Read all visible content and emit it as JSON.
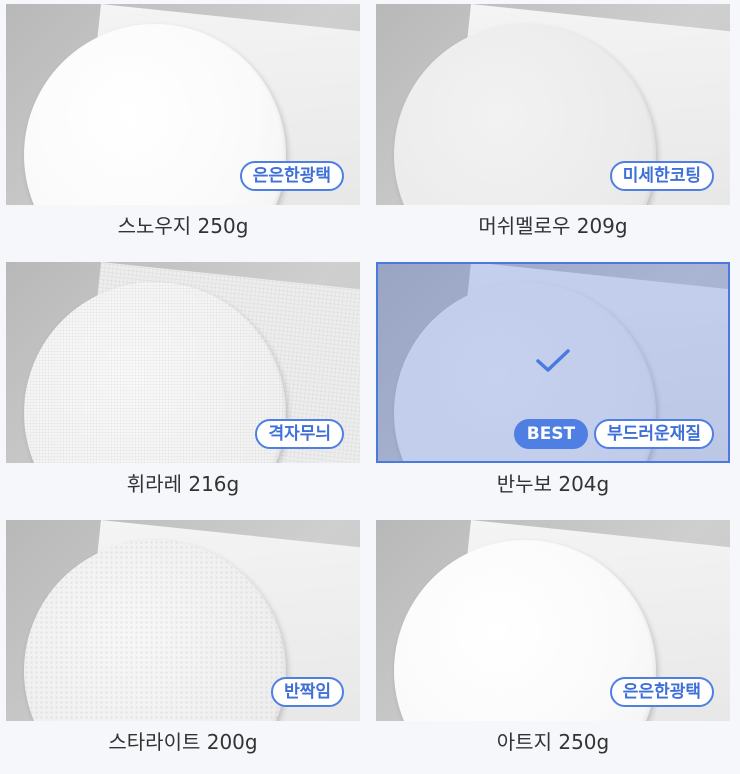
{
  "colors": {
    "accent": "#4f7fe3",
    "selected_overlay": "#4a7ae0",
    "caption_text": "#333333",
    "page_background": "#f6f7fb"
  },
  "papers": [
    {
      "name": "스노우지 250g",
      "tags": [
        "은은한광택"
      ],
      "selected": false,
      "texture": "glossy"
    },
    {
      "name": "머쉬멜로우 209g",
      "tags": [
        "미세한코팅"
      ],
      "selected": false,
      "texture": "matte"
    },
    {
      "name": "휘라레 216g",
      "tags": [
        "격자무늬"
      ],
      "selected": false,
      "texture": "linen"
    },
    {
      "name": "반누보 204g",
      "best_label": "BEST",
      "tags": [
        "부드러운재질"
      ],
      "selected": true,
      "selected_icon": "checkmark-icon",
      "texture": "soft"
    },
    {
      "name": "스타라이트 200g",
      "tags": [
        "반짝임"
      ],
      "selected": false,
      "texture": "sparkle"
    },
    {
      "name": "아트지 250g",
      "tags": [
        "은은한광택"
      ],
      "selected": false,
      "texture": "glossy"
    }
  ]
}
